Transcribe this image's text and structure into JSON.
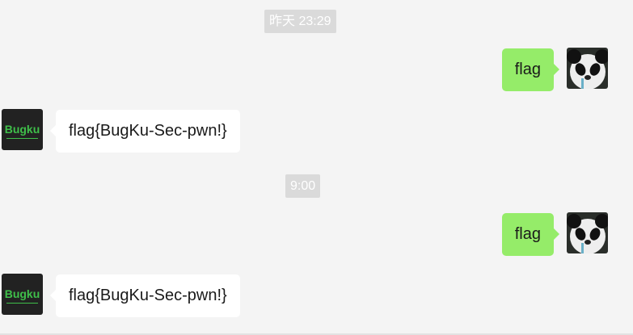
{
  "timestamps": [
    {
      "text": "昨天 23:29"
    },
    {
      "text": "9:00"
    }
  ],
  "messages": [
    {
      "from": "me",
      "text": "flag",
      "avatar_icon": "panda-avatar-icon"
    },
    {
      "from": "bugku",
      "text": "flag{BugKu-Sec-pwn!}",
      "avatar_icon": "bugku-logo-avatar-icon",
      "avatar_text": "Bugku"
    },
    {
      "from": "me",
      "text": "flag",
      "avatar_icon": "panda-avatar-icon"
    },
    {
      "from": "bugku",
      "text": "flag{BugKu-Sec-pwn!}",
      "avatar_icon": "bugku-logo-avatar-icon",
      "avatar_text": "Bugku"
    }
  ],
  "colors": {
    "background": "#f4f4f4",
    "sent_bubble": "#95ec69",
    "received_bubble": "#ffffff",
    "timestamp_pill": "#dadada",
    "bugku_logo_green": "#3fbf4a"
  }
}
